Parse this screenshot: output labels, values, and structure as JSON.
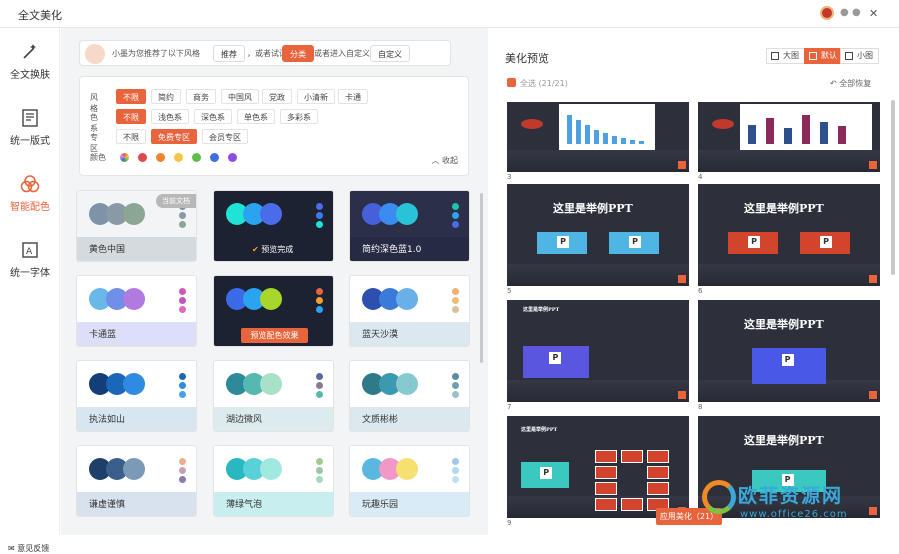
{
  "window": {
    "title": "全文美化",
    "close_label": "✕"
  },
  "sidebar": {
    "items": [
      {
        "label": "全文换肤"
      },
      {
        "label": "统一版式"
      },
      {
        "label": "智能配色"
      },
      {
        "label": "统一字体"
      }
    ],
    "active_index": 2,
    "feedback": "意见反馈"
  },
  "tip": {
    "text1": "小墨为您推荐了以下风格",
    "btn1": "推荐",
    "text2": "，或者试试",
    "btn2": "分类",
    "text3": "或者进入自定义",
    "btn3": "自定义"
  },
  "filter": {
    "style": {
      "label": "风格",
      "options": [
        "不限",
        "简约",
        "商务",
        "中国风",
        "党政",
        "小清新",
        "卡通"
      ]
    },
    "color_family": {
      "label": "色系",
      "options": [
        "不限",
        "浅色系",
        "深色系",
        "单色系",
        "多彩系"
      ]
    },
    "zone": {
      "label": "专区",
      "options": [
        "不限",
        "免费专区",
        "会员专区"
      ]
    },
    "colors": {
      "label": "颜色",
      "values": [
        "#d88ad8",
        "#e0464e",
        "#f0832c",
        "#f6c342",
        "#5fbf4e",
        "#3d6fe0",
        "#8a4fe0"
      ]
    },
    "collapse_label": "收起"
  },
  "cards": [
    {
      "name": "黄色中国",
      "badge": "当前文档",
      "circles": [
        "#7f93a8",
        "#8a9aa5",
        "#8da595"
      ],
      "dots": [
        "#7f93a8",
        "#8a9aa5",
        "#8da595"
      ],
      "top_bg": "#f3f4f6",
      "bottom_bg": "#d5dadf",
      "dark": false
    },
    {
      "name": "",
      "overlay": "预览完成",
      "circles": [
        "#1ee3d6",
        "#2aa4f0",
        "#4a6ce8"
      ],
      "dots": [
        "#4a6ce8",
        "#3a7cf0",
        "#1ee3d6"
      ],
      "top_bg": "#1c2231",
      "bottom_bg": "#1c2231",
      "dark": true
    },
    {
      "name": "简约深色蓝1.0",
      "circles": [
        "#4560d8",
        "#3a8cf0",
        "#29c3d8"
      ],
      "dots": [
        "#1ec3b0",
        "#2aa4f0",
        "#4a6ce8"
      ],
      "top_bg": "#2b2f47",
      "bottom_bg": "#262a42",
      "dark": true
    },
    {
      "name": "卡通蓝",
      "circles": [
        "#6ab8e8",
        "#6f8fe8",
        "#b07ae0"
      ],
      "dots": [
        "#d058b0",
        "#c054c0",
        "#e06ab8"
      ],
      "top_bg": "#ffffff",
      "bottom_bg": "#dcdff7",
      "dark": false
    },
    {
      "name": "",
      "button": "预览配色效果",
      "circles": [
        "#3a6ae8",
        "#2aa4f0",
        "#a8d62a"
      ],
      "dots": [
        "#e8643c",
        "#f0a02c",
        "#2aa4f0"
      ],
      "top_bg": "#1c2231",
      "bottom_bg": "#1c2231",
      "dark": true
    },
    {
      "name": "蓝天沙漠",
      "circles": [
        "#2d4fb0",
        "#3a7ad8",
        "#6ab0e8"
      ],
      "dots": [
        "#f0b070",
        "#e8c07a",
        "#d8c09a"
      ],
      "top_bg": "#ffffff",
      "bottom_bg": "#dce8f0",
      "dark": false
    },
    {
      "name": "执法如山",
      "circles": [
        "#123f7a",
        "#1a66b8",
        "#2f8ae0"
      ],
      "dots": [
        "#1a66b8",
        "#2f8ae0",
        "#4aa0e8"
      ],
      "top_bg": "#ffffff",
      "bottom_bg": "#d8e6f2",
      "dark": false
    },
    {
      "name": "湖边微风",
      "circles": [
        "#2e8a9a",
        "#57b8b0",
        "#a8e0c8"
      ],
      "dots": [
        "#5a6a9a",
        "#8a7a9a",
        "#57b8b0"
      ],
      "top_bg": "#ffffff",
      "bottom_bg": "#dcebee",
      "dark": false
    },
    {
      "name": "文质彬彬",
      "circles": [
        "#2f7a8a",
        "#3a9ab0",
        "#88c8d0"
      ],
      "dots": [
        "#5a8aa0",
        "#6aa0b0",
        "#9ac0c8"
      ],
      "top_bg": "#ffffff",
      "bottom_bg": "#dbe9ef",
      "dark": false
    },
    {
      "name": "谦虚谨慎",
      "circles": [
        "#1e3f6a",
        "#3a5f8a",
        "#7a9ab8"
      ],
      "dots": [
        "#e8b090",
        "#c8a0b0",
        "#8a7ab0"
      ],
      "top_bg": "#ffffff",
      "bottom_bg": "#d8e2ee",
      "dark": false
    },
    {
      "name": "薄绿气泡",
      "circles": [
        "#2ab8c0",
        "#5ad0d8",
        "#a0e8e0"
      ],
      "dots": [
        "#a8c890",
        "#98c8a0",
        "#a8d8c0"
      ],
      "top_bg": "#ffffff",
      "bottom_bg": "#c8eef0",
      "dark": false
    },
    {
      "name": "玩趣乐园",
      "circles": [
        "#5ab8e0",
        "#f098c8",
        "#f6e070"
      ],
      "dots": [
        "#a0c8e8",
        "#b0d8f0",
        "#c0e0f0"
      ],
      "top_bg": "#ffffff",
      "bottom_bg": "#d8ebf6",
      "dark": false
    }
  ],
  "preview": {
    "title": "美化预览",
    "views": [
      "大图",
      "默认",
      "小图"
    ],
    "active_view": 1,
    "select_all": "全选 (21/21)",
    "restore": "全部恢复",
    "apply": "应用美化（21）",
    "slides": [
      {
        "num": "3",
        "kind": "bar"
      },
      {
        "num": "4",
        "kind": "combo"
      },
      {
        "num": "5",
        "kind": "title",
        "text": "这里是举例PPT",
        "ppt": "blue2"
      },
      {
        "num": "6",
        "kind": "title",
        "text": "这里是举例PPT",
        "ppt": "red2"
      },
      {
        "num": "7",
        "kind": "small",
        "text": "这里是举例PPT",
        "ppt": "purple"
      },
      {
        "num": "8",
        "kind": "title",
        "text": "这里是举例PPT",
        "ppt": "blue1"
      },
      {
        "num": "9",
        "kind": "grid",
        "text": "这里是举例PPT"
      },
      {
        "num": "",
        "kind": "title",
        "text": "这里是举例PPT",
        "ppt": "teal"
      }
    ]
  },
  "watermark": {
    "text": "欧菲资源网",
    "url": "www.office26.com"
  }
}
